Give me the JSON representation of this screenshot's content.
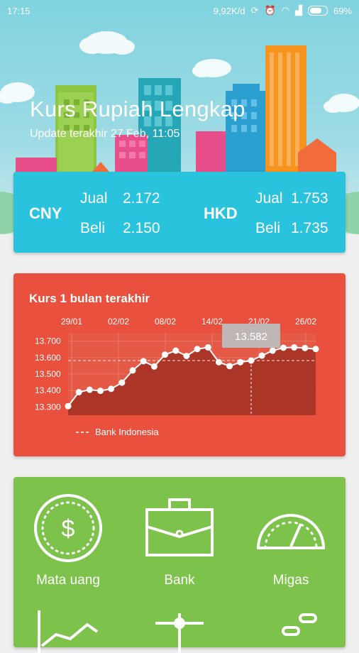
{
  "status_bar": {
    "time": "17:15",
    "network_speed": "9,92K/d",
    "battery": "69%"
  },
  "header": {
    "title": "Kurs Rupiah Lengkap",
    "subtitle": "Update terakhir 27 Feb, 11:05"
  },
  "rates": [
    {
      "currency": "CNY",
      "sell_label": "Jual",
      "sell": "2.172",
      "buy_label": "Beli",
      "buy": "2.150"
    },
    {
      "currency": "HKD",
      "sell_label": "Jual",
      "sell": "1.753",
      "buy_label": "Beli",
      "buy": "1.735"
    }
  ],
  "chart_card": {
    "title": "Kurs 1 bulan terakhir"
  },
  "chart_data": {
    "type": "area",
    "title": "Kurs 1 bulan terakhir",
    "x_tick_labels": [
      "29/01",
      "02/02",
      "08/02",
      "14/02",
      "21/02",
      "26/02"
    ],
    "y_tick_labels": [
      "13.700",
      "13.600",
      "13.500",
      "13.400",
      "13.300"
    ],
    "ylim": [
      13250,
      13750
    ],
    "series": [
      {
        "name": "Bank Indonesia",
        "values": [
          13305,
          13390,
          13405,
          13398,
          13410,
          13448,
          13522,
          13578,
          13546,
          13618,
          13642,
          13610,
          13652,
          13662,
          13572,
          13548,
          13572,
          13582,
          13612,
          13642,
          13660,
          13662,
          13658,
          13652
        ]
      }
    ],
    "tooltip": {
      "label": "13.582",
      "index": 17
    },
    "reference_line": true,
    "legend_position": "bottom-left"
  },
  "menu": {
    "items": [
      {
        "label": "Mata uang",
        "icon": "dollar-coin-icon"
      },
      {
        "label": "Bank",
        "icon": "briefcase-icon"
      },
      {
        "label": "Migas",
        "icon": "gauge-icon"
      }
    ]
  },
  "colors": {
    "rate_card": "#29c3de",
    "chart_card": "#e9503d",
    "menu_card": "#7dc24b"
  }
}
